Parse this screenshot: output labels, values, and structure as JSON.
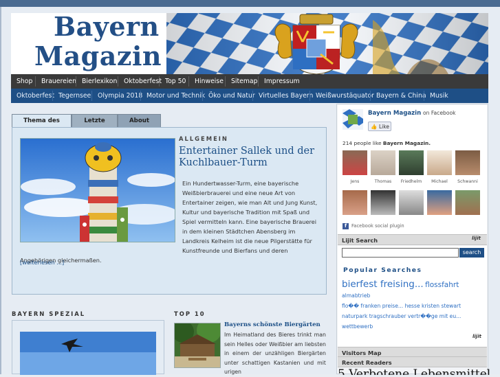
{
  "header": {
    "logo_line1": "Bayern",
    "logo_line2": "Magazin"
  },
  "nav_primary": [
    "Shop",
    "Brauereien",
    "Bierlexikon",
    "Oktoberfest",
    "Top 50",
    "Hinweise",
    "Sitemap",
    "Impressum"
  ],
  "nav_secondary": [
    "Oktoberfest",
    "Tegernsee",
    "Olympia 2018",
    "Motor und Technik",
    "Öko und Natur",
    "Virtuelles Bayern",
    "Weißwurstäquator",
    "Bayern & China",
    "Musik"
  ],
  "tabs": [
    "Thema des Monats",
    "Letzte Artikel",
    "About"
  ],
  "featured": {
    "category": "ALLGEMEIN",
    "title": "Entertainer Sallek und der Kuchlbauer-Turm",
    "body": "Ein Hundertwasser-Turm, eine bayerische Weißbierbrauerei und eine neue Art von Entertainer zeigen, wie man Alt und Jung Kunst, Kultur und bayerische Tradition mit Spaß und Spiel vermitteln kann. Eine bayerische Brauerei in dem kleinen Städtchen Abensberg im Landkreis Kelheim ist die neue Pilgerstätte für Kunstfreunde und Bierfans und deren Angehörigen gleichermaßen.",
    "read_more": "[weiterlesen ...]"
  },
  "bayern_spezial": {
    "heading": "BAYERN SPEZIAL"
  },
  "top10": {
    "heading": "TOP 10",
    "title": "Bayerns schönste Biergärten",
    "body": "Im Heimatland des Bieres trinkt man sein Helles oder Weißbier am liebsten in einem der unzähligen Biergärten unter schattigen Kastanien und mit urigen"
  },
  "facebook": {
    "page_name": "Bayern Magazin",
    "on_facebook": "on Facebook",
    "like_button": "Like",
    "like_count_text": "214 people like",
    "like_count_page": "Bayern Magazin.",
    "faces_row1": [
      "Jens",
      "Thomas",
      "Friedhelm",
      "Michael",
      "Schwanni"
    ],
    "plugin_label": "Facebook social plugin"
  },
  "lijit": {
    "heading": "Lijit Search",
    "search_button": "search",
    "popular_heading": "Popular Searches",
    "tags": [
      "bierfest freising...",
      "flossfahrt",
      "almabtrieb",
      "flo�� franken preise...",
      "hesse kristen stewart",
      "naturpark tragschrauber vertr��ge mit eu...",
      "wettbewerb"
    ]
  },
  "sidebar_links": {
    "visitors_map": "Visitors Map",
    "recent_readers": "Recent Readers"
  },
  "bottom_banner_text": "5 Verbotene Lebensmittel :",
  "colors": {
    "primary_blue": "#1e4f86",
    "nav_dark": "#3a3a3a",
    "feature_bg": "#dbe8f3"
  }
}
